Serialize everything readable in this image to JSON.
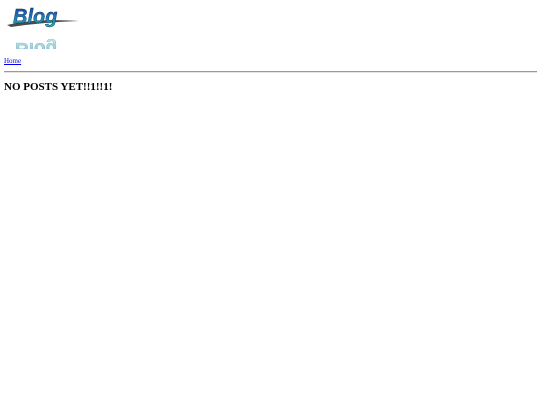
{
  "header": {
    "logo_text": "Blog"
  },
  "nav": {
    "home_label": "Home"
  },
  "main": {
    "heading": "NO POSTS YET!!1!!1!"
  },
  "colors": {
    "link": "#0000ee",
    "logo_top": "#1f5aa8",
    "logo_bottom": "#24b394",
    "swoosh": "#555555"
  }
}
